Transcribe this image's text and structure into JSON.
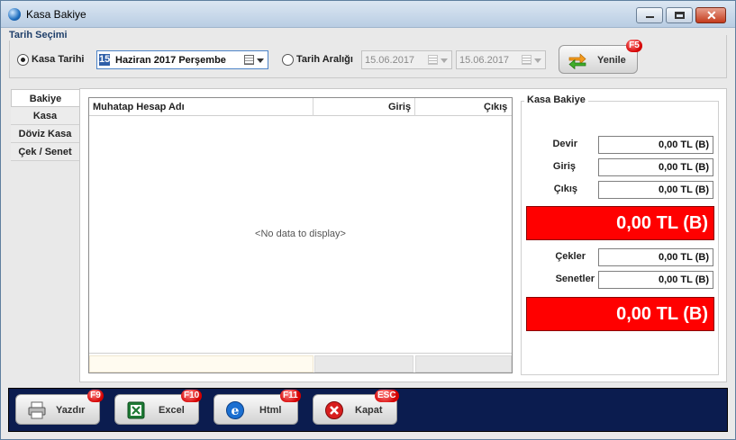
{
  "window": {
    "title": "Kasa Bakiye"
  },
  "date_group": {
    "legend": "Tarih Seçimi",
    "kasa_tarihi_label": "Kasa Tarihi",
    "selected_day": "15",
    "selected_date_text": "Haziran  2017 Perşembe",
    "tarih_araligi_label": "Tarih Aralığı",
    "range_start": "15.06.2017",
    "range_end": "15.06.2017",
    "refresh_label": "Yenile",
    "refresh_key": "F5"
  },
  "tabs": [
    {
      "label": "Bakiye"
    },
    {
      "label": "Kasa"
    },
    {
      "label": "Döviz Kasa"
    },
    {
      "label": "Çek / Senet"
    }
  ],
  "grid": {
    "columns": [
      "Muhatap Hesap Adı",
      "Giriş",
      "Çıkış"
    ],
    "empty_text": "<No data to display>"
  },
  "balance": {
    "legend": "Kasa Bakiye",
    "devir_label": "Devir",
    "devir_value": "0,00 TL (B)",
    "giris_label": "Giriş",
    "giris_value": "0,00 TL (B)",
    "cikis_label": "Çıkış",
    "cikis_value": "0,00 TL (B)",
    "total_1": "0,00 TL (B)",
    "cekler_label": "Çekler",
    "cekler_value": "0,00 TL (B)",
    "senetler_label": "Senetler",
    "senetler_value": "0,00 TL (B)",
    "total_2": "0,00 TL (B)"
  },
  "actions": {
    "print_label": "Yazdır",
    "print_key": "F9",
    "excel_label": "Excel",
    "excel_key": "F10",
    "html_label": "Html",
    "html_key": "F11",
    "close_label": "Kapat",
    "close_key": "ESC"
  },
  "colors": {
    "accent_red": "#ff0000",
    "bottom_bar": "#0b1c4f",
    "badge_red": "#d40000"
  }
}
